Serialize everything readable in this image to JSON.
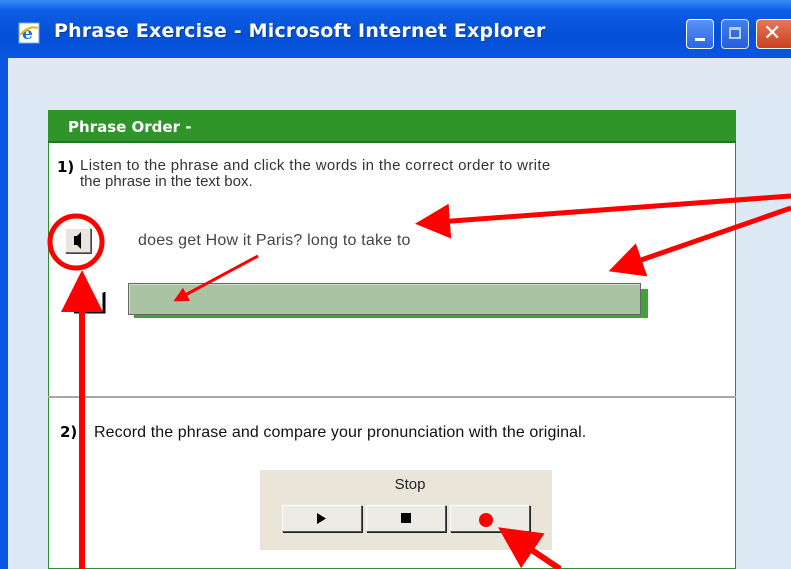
{
  "window": {
    "title": "Phrase Exercise - Microsoft Internet Explorer",
    "icon": "ie-icon",
    "controls": [
      "minimize-icon",
      "maximize-icon",
      "close-icon"
    ]
  },
  "panel": {
    "header": "Phrase Order -",
    "accent_color": "#2f9429"
  },
  "question1": {
    "number": "1)",
    "text_line1": "Listen to the phrase and click the words in the correct order to write",
    "text_line2": "the phrase in the text box.",
    "scrambled_words": "does get How it Paris? long to take to",
    "answer_value": ""
  },
  "question2": {
    "number": "2)",
    "text": "Record the phrase and compare your pronunciation with the original."
  },
  "recorder": {
    "status": "Stop",
    "buttons": [
      "play-icon",
      "stop-icon",
      "record-icon"
    ],
    "record_color": "#ff0000"
  },
  "annotations": {
    "color": "#ff0000"
  }
}
